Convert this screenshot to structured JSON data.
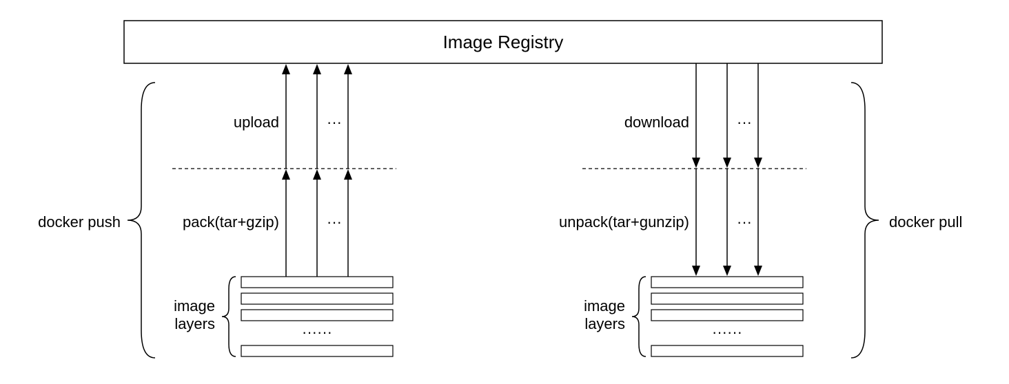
{
  "registry": {
    "title": "Image Registry"
  },
  "left": {
    "outerLabel": "docker push",
    "stage1": "upload",
    "stage2": "pack(tar+gzip)",
    "ellipsis1": "···",
    "ellipsis2": "···",
    "layersLabel1": "image",
    "layersLabel2": "layers",
    "layersEllipsis": "······"
  },
  "right": {
    "outerLabel": "docker pull",
    "stage1": "download",
    "stage2": "unpack(tar+gunzip)",
    "ellipsis1": "···",
    "ellipsis2": "···",
    "layersLabel1": "image",
    "layersLabel2": "layers",
    "layersEllipsis": "······"
  }
}
